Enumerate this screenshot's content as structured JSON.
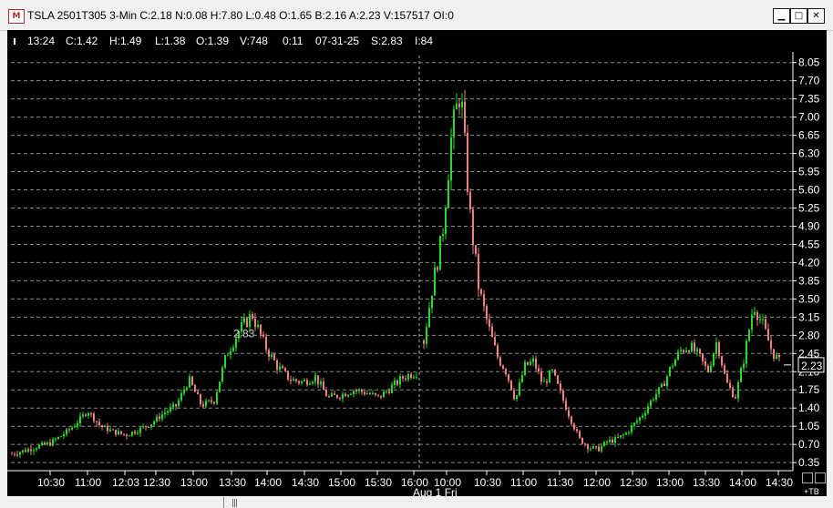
{
  "window": {
    "title": "TSLA 2501T305 3-Min C:2.18 N:0.08 H:7.80 L:0.48 O:1.65 B:2.16 A:2.23 V:157517 OI:0",
    "icon_name": "chart-app-icon",
    "buttons": [
      "minimize-icon",
      "maximize-icon",
      "close-icon"
    ]
  },
  "infobar": {
    "items": [
      "13:24",
      "C:1.42",
      "H:1.49",
      "L:1.38",
      "O:1.39",
      "V:748",
      "0:11",
      "07-31-25",
      "S:2.83",
      "I:84"
    ]
  },
  "chart_data": {
    "type": "candlestick",
    "title": "",
    "xlabel": "",
    "ylabel": "",
    "ylim": [
      0.3,
      8.15
    ],
    "yticks": [
      "8.05",
      "7.70",
      "7.35",
      "7.00",
      "6.65",
      "6.30",
      "5.95",
      "5.60",
      "5.25",
      "4.90",
      "4.55",
      "4.20",
      "3.85",
      "3.50",
      "3.15",
      "2.80",
      "2.45",
      "2.10",
      "1.75",
      "1.40",
      "1.05",
      "0.70",
      "0.35"
    ],
    "xticks": [
      "10:30",
      "11:00",
      "12:03",
      "12:30",
      "13:00",
      "13:30",
      "14:00",
      "14:30",
      "15:00",
      "15:30",
      "16:00",
      "10:00",
      "10:30",
      "11:00",
      "11:30",
      "12:00",
      "12:30",
      "13:00",
      "13:30",
      "14:00",
      "14:30"
    ],
    "session_break_label": "Aug 1 Fri",
    "current_price": "2.23",
    "annotation": "2.83",
    "grid": true,
    "up_color": "#22dd22",
    "down_color": "#f08080",
    "series": [
      {
        "segment": "Jul 31",
        "t": [
          0,
          14,
          28,
          42,
          56,
          70,
          84,
          98,
          112,
          126,
          140,
          154,
          168,
          182,
          196,
          210,
          224,
          238,
          252,
          266,
          280,
          294,
          308,
          322,
          336,
          350,
          364,
          378,
          392,
          406,
          420,
          434,
          448
        ],
        "close": [
          0.52,
          0.58,
          0.66,
          0.72,
          0.88,
          1.08,
          1.35,
          1.05,
          0.95,
          0.88,
          0.98,
          1.1,
          1.3,
          1.45,
          1.95,
          1.45,
          1.55,
          2.45,
          2.9,
          3.2,
          2.6,
          2.2,
          1.95,
          1.9,
          2.0,
          1.6,
          1.65,
          1.75,
          1.7,
          1.6,
          1.8,
          2.0,
          2.1
        ]
      },
      {
        "segment": "Aug 1",
        "t": [
          460,
          470,
          480,
          490,
          500,
          510,
          520,
          530,
          540,
          550,
          560,
          570,
          580,
          590,
          600,
          610,
          620,
          630,
          640,
          650,
          660,
          670,
          680,
          690,
          700,
          710,
          720,
          730,
          740,
          750,
          760,
          770,
          780,
          790,
          800,
          810,
          820,
          830,
          840,
          850
        ],
        "close": [
          2.7,
          3.8,
          4.7,
          6.6,
          7.55,
          5.2,
          3.7,
          3.0,
          2.4,
          2.1,
          1.55,
          2.2,
          2.3,
          1.85,
          2.1,
          1.65,
          1.2,
          0.8,
          0.65,
          0.6,
          0.75,
          0.8,
          0.9,
          1.1,
          1.3,
          1.6,
          1.8,
          2.2,
          2.5,
          2.6,
          2.4,
          2.1,
          2.7,
          1.9,
          1.6,
          2.4,
          3.4,
          3.0,
          2.5,
          2.23
        ]
      }
    ]
  }
}
